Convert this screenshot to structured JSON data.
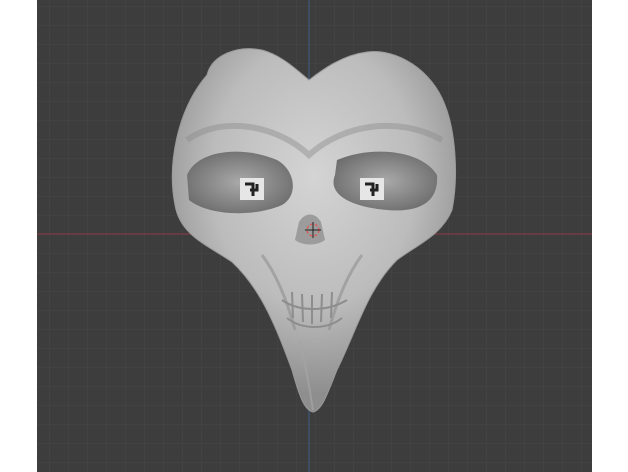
{
  "viewport": {
    "background": "#3d3d3d",
    "grid_color": "#474747",
    "x_axis_color": "#8a3b45",
    "y_axis_color": "#3f5f86",
    "model_color": "#bdbdbd",
    "model_shadow": "#6a6a6a",
    "object_name": "skull sculpt"
  },
  "icons": {
    "origin": "3d-cursor-icon",
    "eye_marker": "eye-marker-icon"
  }
}
